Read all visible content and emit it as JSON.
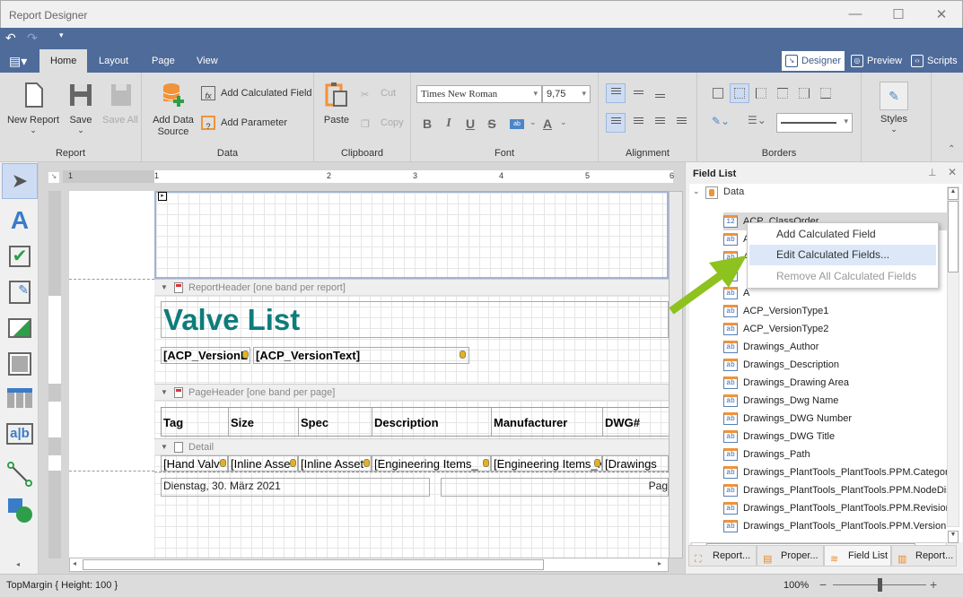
{
  "window": {
    "title": "Report Designer"
  },
  "ribbon": {
    "tabs": [
      "Home",
      "Layout",
      "Page",
      "View"
    ],
    "active_tab": "Home",
    "views": [
      "Designer",
      "Preview",
      "Scripts"
    ],
    "active_view": "Designer",
    "groups": {
      "report": {
        "label": "Report",
        "new_report": "New Report",
        "save": "Save",
        "save_all": "Save All"
      },
      "data": {
        "label": "Data",
        "add_data_source": "Add Data Source",
        "add_calculated_field": "Add Calculated Field",
        "add_parameter": "Add Parameter"
      },
      "clipboard": {
        "label": "Clipboard",
        "paste": "Paste",
        "cut": "Cut",
        "copy": "Copy"
      },
      "font": {
        "label": "Font",
        "font_name": "Times New Roman",
        "font_size": "9,75",
        "bold": "B",
        "italic": "I",
        "underline": "U",
        "strike": "S",
        "highlight": "ab",
        "color": "A"
      },
      "alignment": {
        "label": "Alignment"
      },
      "borders": {
        "label": "Borders"
      },
      "styles": {
        "label": "Styles"
      }
    }
  },
  "ruler": {
    "marks": [
      "1",
      "1",
      "2",
      "3",
      "4",
      "5",
      "6"
    ]
  },
  "report": {
    "report_header_band": "ReportHeader [one band per report]",
    "title": "Valve List",
    "version_label": "[ACP_VersionL",
    "version_text": "[ACP_VersionText]",
    "page_header_band": "PageHeader [one band per page]",
    "columns": [
      "Tag",
      "Size",
      "Spec",
      "Description",
      "Manufacturer",
      "DWG#"
    ],
    "detail_band": "Detail",
    "detail_fields": [
      "[Hand Valv",
      "[Inline Asse",
      "[Inline Asset",
      "[Engineering Items_",
      "[Engineering Items_M",
      "[Drawings"
    ],
    "footer_date": "Dienstag, 30. März 2021",
    "footer_page": "Pag",
    "title_color": "#0e7c7b"
  },
  "field_list": {
    "title": "Field List",
    "root": "Data",
    "items": [
      {
        "label": "ACP_ClassOrder",
        "type": "12"
      },
      {
        "label": "A",
        "type": "ab"
      },
      {
        "label": "A",
        "type": "ab"
      },
      {
        "label": "",
        "type": "ab"
      },
      {
        "label": "A",
        "type": "ab"
      },
      {
        "label": "ACP_VersionType1",
        "type": "ab"
      },
      {
        "label": "ACP_VersionType2",
        "type": "ab"
      },
      {
        "label": "Drawings_Author",
        "type": "ab"
      },
      {
        "label": "Drawings_Description",
        "type": "ab"
      },
      {
        "label": "Drawings_Drawing Area",
        "type": "ab"
      },
      {
        "label": "Drawings_Dwg Name",
        "type": "ab"
      },
      {
        "label": "Drawings_DWG Number",
        "type": "ab"
      },
      {
        "label": "Drawings_DWG Title",
        "type": "ab"
      },
      {
        "label": "Drawings_Path",
        "type": "ab"
      },
      {
        "label": "Drawings_PlantTools_PlantTools.PPM.Category",
        "type": "ab"
      },
      {
        "label": "Drawings_PlantTools_PlantTools.PPM.NodeDispl",
        "type": "ab"
      },
      {
        "label": "Drawings_PlantTools_PlantTools.PPM.Revision",
        "type": "ab"
      },
      {
        "label": "Drawings_PlantTools_PlantTools.PPM.Version",
        "type": "ab"
      }
    ],
    "context_menu": [
      "Add Calculated Field",
      "Edit Calculated Fields...",
      "Remove All Calculated Fields"
    ],
    "tabs": [
      "Report...",
      "Proper...",
      "Field List",
      "Report..."
    ],
    "active_tab": "Field List"
  },
  "status": {
    "selection": "TopMargin { Height: 100 }",
    "zoom": "100%",
    "zoom_fraction": 0.5
  },
  "colors": {
    "accent": "#4e6b9a",
    "arrow": "#8dc21f"
  }
}
